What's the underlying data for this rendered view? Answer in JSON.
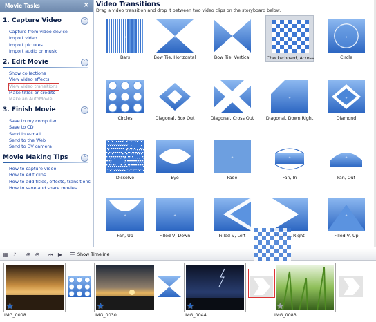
{
  "taskpane": {
    "header": "Movie Tasks",
    "close": "×",
    "sections": [
      {
        "title": "1. Capture Video",
        "items": [
          {
            "label": "Capture from video device",
            "disabled": false
          },
          {
            "label": "Import video",
            "disabled": false
          },
          {
            "label": "Import pictures",
            "disabled": false
          },
          {
            "label": "Import audio or music",
            "disabled": false
          }
        ]
      },
      {
        "title": "2. Edit Movie",
        "items": [
          {
            "label": "Show collections",
            "disabled": false
          },
          {
            "label": "View video effects",
            "disabled": false
          },
          {
            "label": "View video transitions",
            "disabled": true,
            "boxed": true
          },
          {
            "label": "Make titles or credits",
            "disabled": false
          },
          {
            "label": "Make an AutoMovie",
            "disabled": true
          }
        ]
      },
      {
        "title": "3. Finish Movie",
        "items": [
          {
            "label": "Save to my computer",
            "disabled": false
          },
          {
            "label": "Save to CD",
            "disabled": false
          },
          {
            "label": "Send in e-mail",
            "disabled": false
          },
          {
            "label": "Send to the Web",
            "disabled": false
          },
          {
            "label": "Send to DV camera",
            "disabled": false
          }
        ]
      },
      {
        "title": "Movie Making Tips",
        "items": [
          {
            "label": "How to capture video",
            "disabled": false
          },
          {
            "label": "How to edit clips",
            "disabled": false
          },
          {
            "label": "How to add titles, effects, transitions",
            "disabled": false
          },
          {
            "label": "How to save and share movies",
            "disabled": false
          }
        ]
      }
    ]
  },
  "content": {
    "title": "Video Transitions",
    "subtitle": "Drag a video transition and drop it between two video clips on the storyboard below.",
    "transitions": [
      {
        "name": "Bars",
        "icon": "bars"
      },
      {
        "name": "Bow Tie, Horizontal",
        "icon": "bowtie-h"
      },
      {
        "name": "Bow Tie, Vertical",
        "icon": "bowtie-v"
      },
      {
        "name": "Checkerboard, Across",
        "icon": "checker",
        "selected": true
      },
      {
        "name": "Circle",
        "icon": "circle"
      },
      {
        "name": "Circles",
        "icon": "circles"
      },
      {
        "name": "Diagonal, Box Out",
        "icon": "diag-box"
      },
      {
        "name": "Diagonal, Cross Out",
        "icon": "diag-cross"
      },
      {
        "name": "Diagonal, Down Right",
        "icon": "diag-down"
      },
      {
        "name": "Diamond",
        "icon": "diamond"
      },
      {
        "name": "Dissolve",
        "icon": "dissolve"
      },
      {
        "name": "Eye",
        "icon": "eye"
      },
      {
        "name": "Fade",
        "icon": "fade"
      },
      {
        "name": "Fan, In",
        "icon": "fan-in"
      },
      {
        "name": "Fan, Out",
        "icon": "fan-out"
      },
      {
        "name": "Fan, Up",
        "icon": "fan-up"
      },
      {
        "name": "Filled V, Down",
        "icon": "v-down"
      },
      {
        "name": "Filled V, Left",
        "icon": "v-left"
      },
      {
        "name": "Filled V, Right",
        "icon": "v-right"
      },
      {
        "name": "Filled V, Up",
        "icon": "v-up"
      }
    ]
  },
  "storyboard": {
    "show_timeline": "Show Timeline",
    "clips": [
      {
        "name": "IMG_0008",
        "scene": "sunset-rocks"
      },
      {
        "name": "IMG_0030",
        "scene": "sunset-beach"
      },
      {
        "name": "IMG_0044",
        "scene": "night-lightning"
      },
      {
        "name": "IMG_0083",
        "scene": "grass"
      }
    ]
  },
  "colors": {
    "accent": "#2f6fca",
    "link": "#1440a8",
    "drop_outline": "#d33333"
  }
}
